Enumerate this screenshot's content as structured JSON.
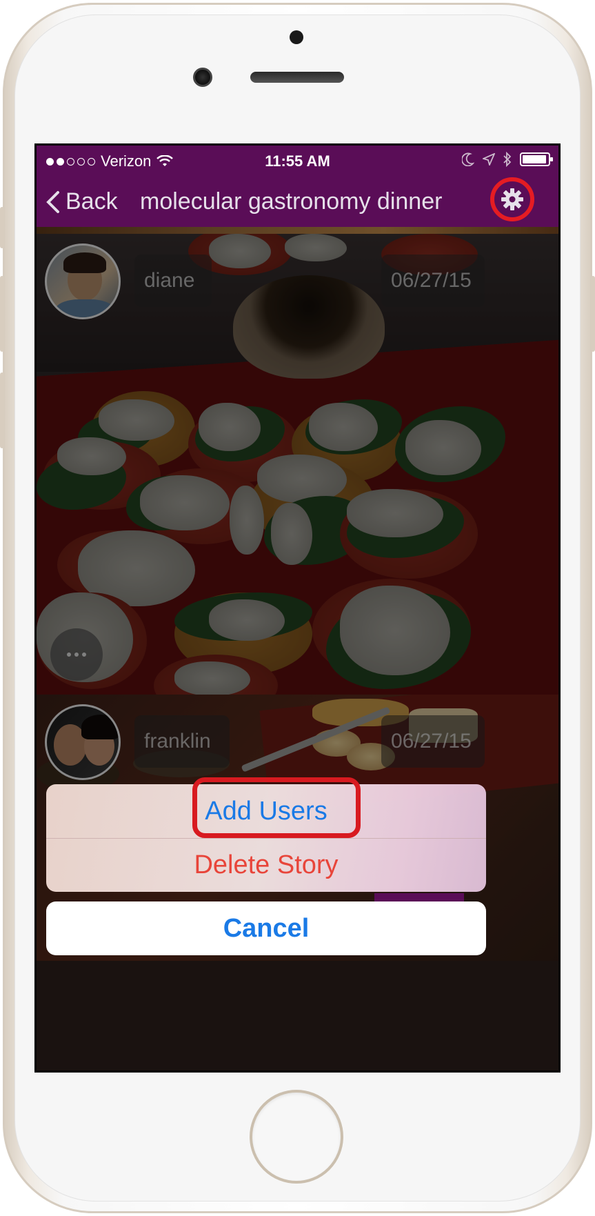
{
  "status_bar": {
    "carrier": "Verizon",
    "time": "11:55 AM"
  },
  "nav": {
    "back_label": "Back",
    "title": "molecular gastronomy dinner",
    "settings_icon": "gear-icon"
  },
  "posts": [
    {
      "author": "diane",
      "date": "06/27/15"
    },
    {
      "author": "franklin",
      "date": "06/27/15"
    }
  ],
  "action_sheet": {
    "add_users": "Add Users",
    "delete_story": "Delete Story",
    "cancel": "Cancel"
  },
  "colors": {
    "brand_purple": "#5a0d57",
    "ios_blue": "#1a7ae6",
    "destructive_red": "#e8453a",
    "highlight_red": "#d81a20"
  }
}
